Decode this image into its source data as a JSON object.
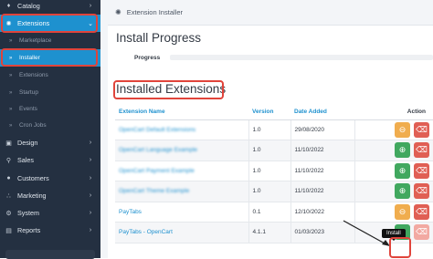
{
  "sidebar": {
    "items": [
      {
        "label": "Catalog",
        "icon": "tag-icon"
      },
      {
        "label": "Extensions",
        "icon": "puzzle-icon"
      },
      {
        "label": "Design",
        "icon": "monitor-icon"
      },
      {
        "label": "Sales",
        "icon": "cart-icon"
      },
      {
        "label": "Customers",
        "icon": "user-icon"
      },
      {
        "label": "Marketing",
        "icon": "share-icon"
      },
      {
        "label": "System",
        "icon": "gear-icon"
      },
      {
        "label": "Reports",
        "icon": "chart-icon"
      }
    ],
    "sub_items": [
      {
        "label": "Marketplace"
      },
      {
        "label": "Installer"
      },
      {
        "label": "Extensions"
      },
      {
        "label": "Startup"
      },
      {
        "label": "Events"
      },
      {
        "label": "Cron Jobs"
      }
    ]
  },
  "header": {
    "title": "Extension Installer"
  },
  "progress": {
    "heading": "Install Progress",
    "label": "Progress",
    "value": 0
  },
  "installed": {
    "heading": "Installed Extensions",
    "columns": {
      "name": "Extension Name",
      "version": "Version",
      "date": "Date Added",
      "action": "Action"
    },
    "rows": [
      {
        "name": "OpenCart Default Extensions",
        "version": "1.0",
        "date": "29/08/2020"
      },
      {
        "name": "OpenCart Language Example",
        "version": "1.0",
        "date": "11/10/2022"
      },
      {
        "name": "OpenCart Payment Example",
        "version": "1.0",
        "date": "11/10/2022"
      },
      {
        "name": "OpenCart Theme Example",
        "version": "1.0",
        "date": "11/10/2022"
      },
      {
        "name": "PayTabs",
        "version": "0.1",
        "date": "12/10/2022"
      },
      {
        "name": "PayTabs - OpenCart",
        "version": "4.1.1",
        "date": "01/03/2023"
      }
    ]
  },
  "tooltip": {
    "text": "Install"
  },
  "colors": {
    "accent": "#1e91cf",
    "highlight": "#e0443b",
    "install": "#41a85f",
    "uninstall": "#f0ad4e",
    "delete": "#e05f54"
  }
}
